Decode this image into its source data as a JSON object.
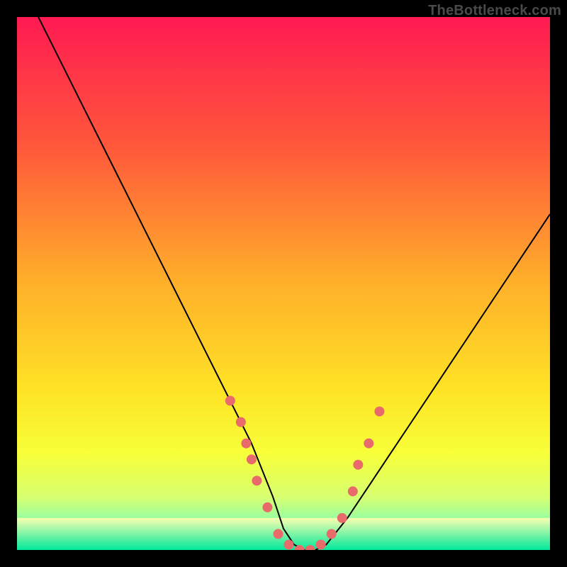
{
  "watermark": "TheBottleneck.com",
  "chart_data": {
    "type": "line",
    "title": "",
    "xlabel": "",
    "ylabel": "",
    "xlim": [
      0,
      100
    ],
    "ylim": [
      0,
      100
    ],
    "grid": false,
    "legend": false,
    "background": {
      "type": "vertical-gradient",
      "stops": [
        {
          "pos": 0.0,
          "color": "#ff1a52"
        },
        {
          "pos": 0.25,
          "color": "#ff5a3a"
        },
        {
          "pos": 0.5,
          "color": "#ffb02a"
        },
        {
          "pos": 0.7,
          "color": "#ffe326"
        },
        {
          "pos": 0.82,
          "color": "#f7ff3a"
        },
        {
          "pos": 0.9,
          "color": "#d8ff70"
        },
        {
          "pos": 0.96,
          "color": "#7dffb5"
        },
        {
          "pos": 1.0,
          "color": "#00f0a0"
        }
      ]
    },
    "series": [
      {
        "name": "bottleneck-curve",
        "stroke": "#000000",
        "stroke_width": 2,
        "x": [
          4,
          8,
          12,
          16,
          20,
          24,
          28,
          32,
          36,
          40,
          44,
          48,
          50,
          52,
          54,
          56,
          58,
          62,
          66,
          70,
          74,
          78,
          82,
          86,
          90,
          94,
          98,
          100
        ],
        "y": [
          100,
          92,
          84,
          76,
          68,
          60,
          52,
          44,
          36,
          28,
          20,
          10,
          4,
          1,
          0,
          0,
          1,
          6,
          12,
          18,
          24,
          30,
          36,
          42,
          48,
          54,
          60,
          63
        ]
      }
    ],
    "markers": {
      "name": "highlight-dots",
      "color": "#e86a6a",
      "radius": 7,
      "points": [
        {
          "x": 40,
          "y": 28
        },
        {
          "x": 42,
          "y": 24
        },
        {
          "x": 43,
          "y": 20
        },
        {
          "x": 44,
          "y": 17
        },
        {
          "x": 45,
          "y": 13
        },
        {
          "x": 47,
          "y": 8
        },
        {
          "x": 49,
          "y": 3
        },
        {
          "x": 51,
          "y": 1
        },
        {
          "x": 53,
          "y": 0
        },
        {
          "x": 55,
          "y": 0
        },
        {
          "x": 57,
          "y": 1
        },
        {
          "x": 59,
          "y": 3
        },
        {
          "x": 61,
          "y": 6
        },
        {
          "x": 63,
          "y": 11
        },
        {
          "x": 64,
          "y": 16
        },
        {
          "x": 66,
          "y": 20
        },
        {
          "x": 68,
          "y": 26
        }
      ]
    },
    "bottom_band": {
      "color_top": "#faffb0",
      "color_bottom": "#00e89a",
      "y_from": 0,
      "y_to": 6
    }
  }
}
